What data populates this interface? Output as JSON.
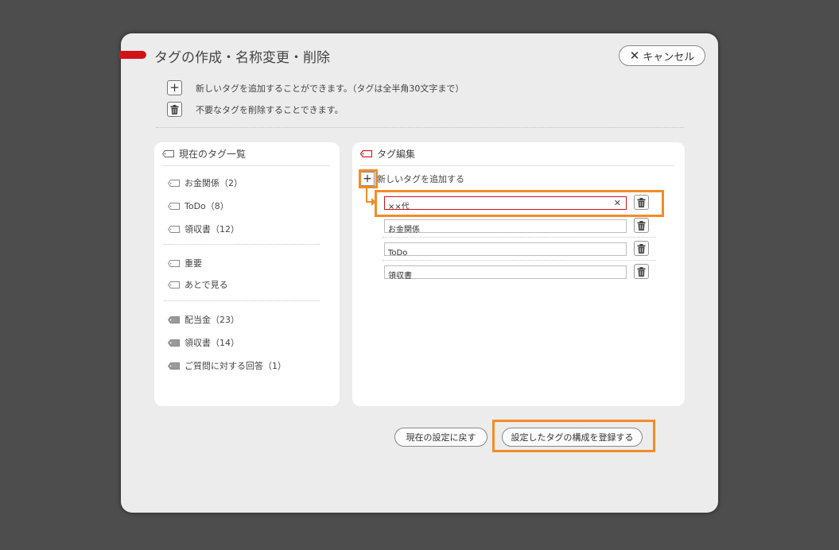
{
  "dialog": {
    "title": "タグの作成・名称変更・削除",
    "cancel_label": "キャンセル",
    "info": {
      "add_text": "新しいタグを追加することができます。（タグは全半角30文字まで）",
      "delete_text": "不要なタグを削除することできます。"
    }
  },
  "current_tags": {
    "title": "現在のタグ一覧",
    "group1": [
      "お金関係（2）",
      "ToDo（8）",
      "領収書（12）"
    ],
    "group2": [
      "重要",
      "あとで見る"
    ],
    "group3": [
      "配当金（23）",
      "領収書（14）",
      "ご質問に対する回答（1）"
    ]
  },
  "tag_edit": {
    "title": "タグ編集",
    "add_label": "新しいタグを追加する",
    "new_tag_value": "××代",
    "tags": [
      "お金関係",
      "ToDo",
      "領収書"
    ]
  },
  "footer": {
    "reset_label": "現在の設定に戻す",
    "save_label": "設定したタグの構成を登録する"
  },
  "colors": {
    "accent": "#d01219",
    "highlight": "#f28c28",
    "background": "#4d4d4d",
    "dialog": "#ececec"
  }
}
